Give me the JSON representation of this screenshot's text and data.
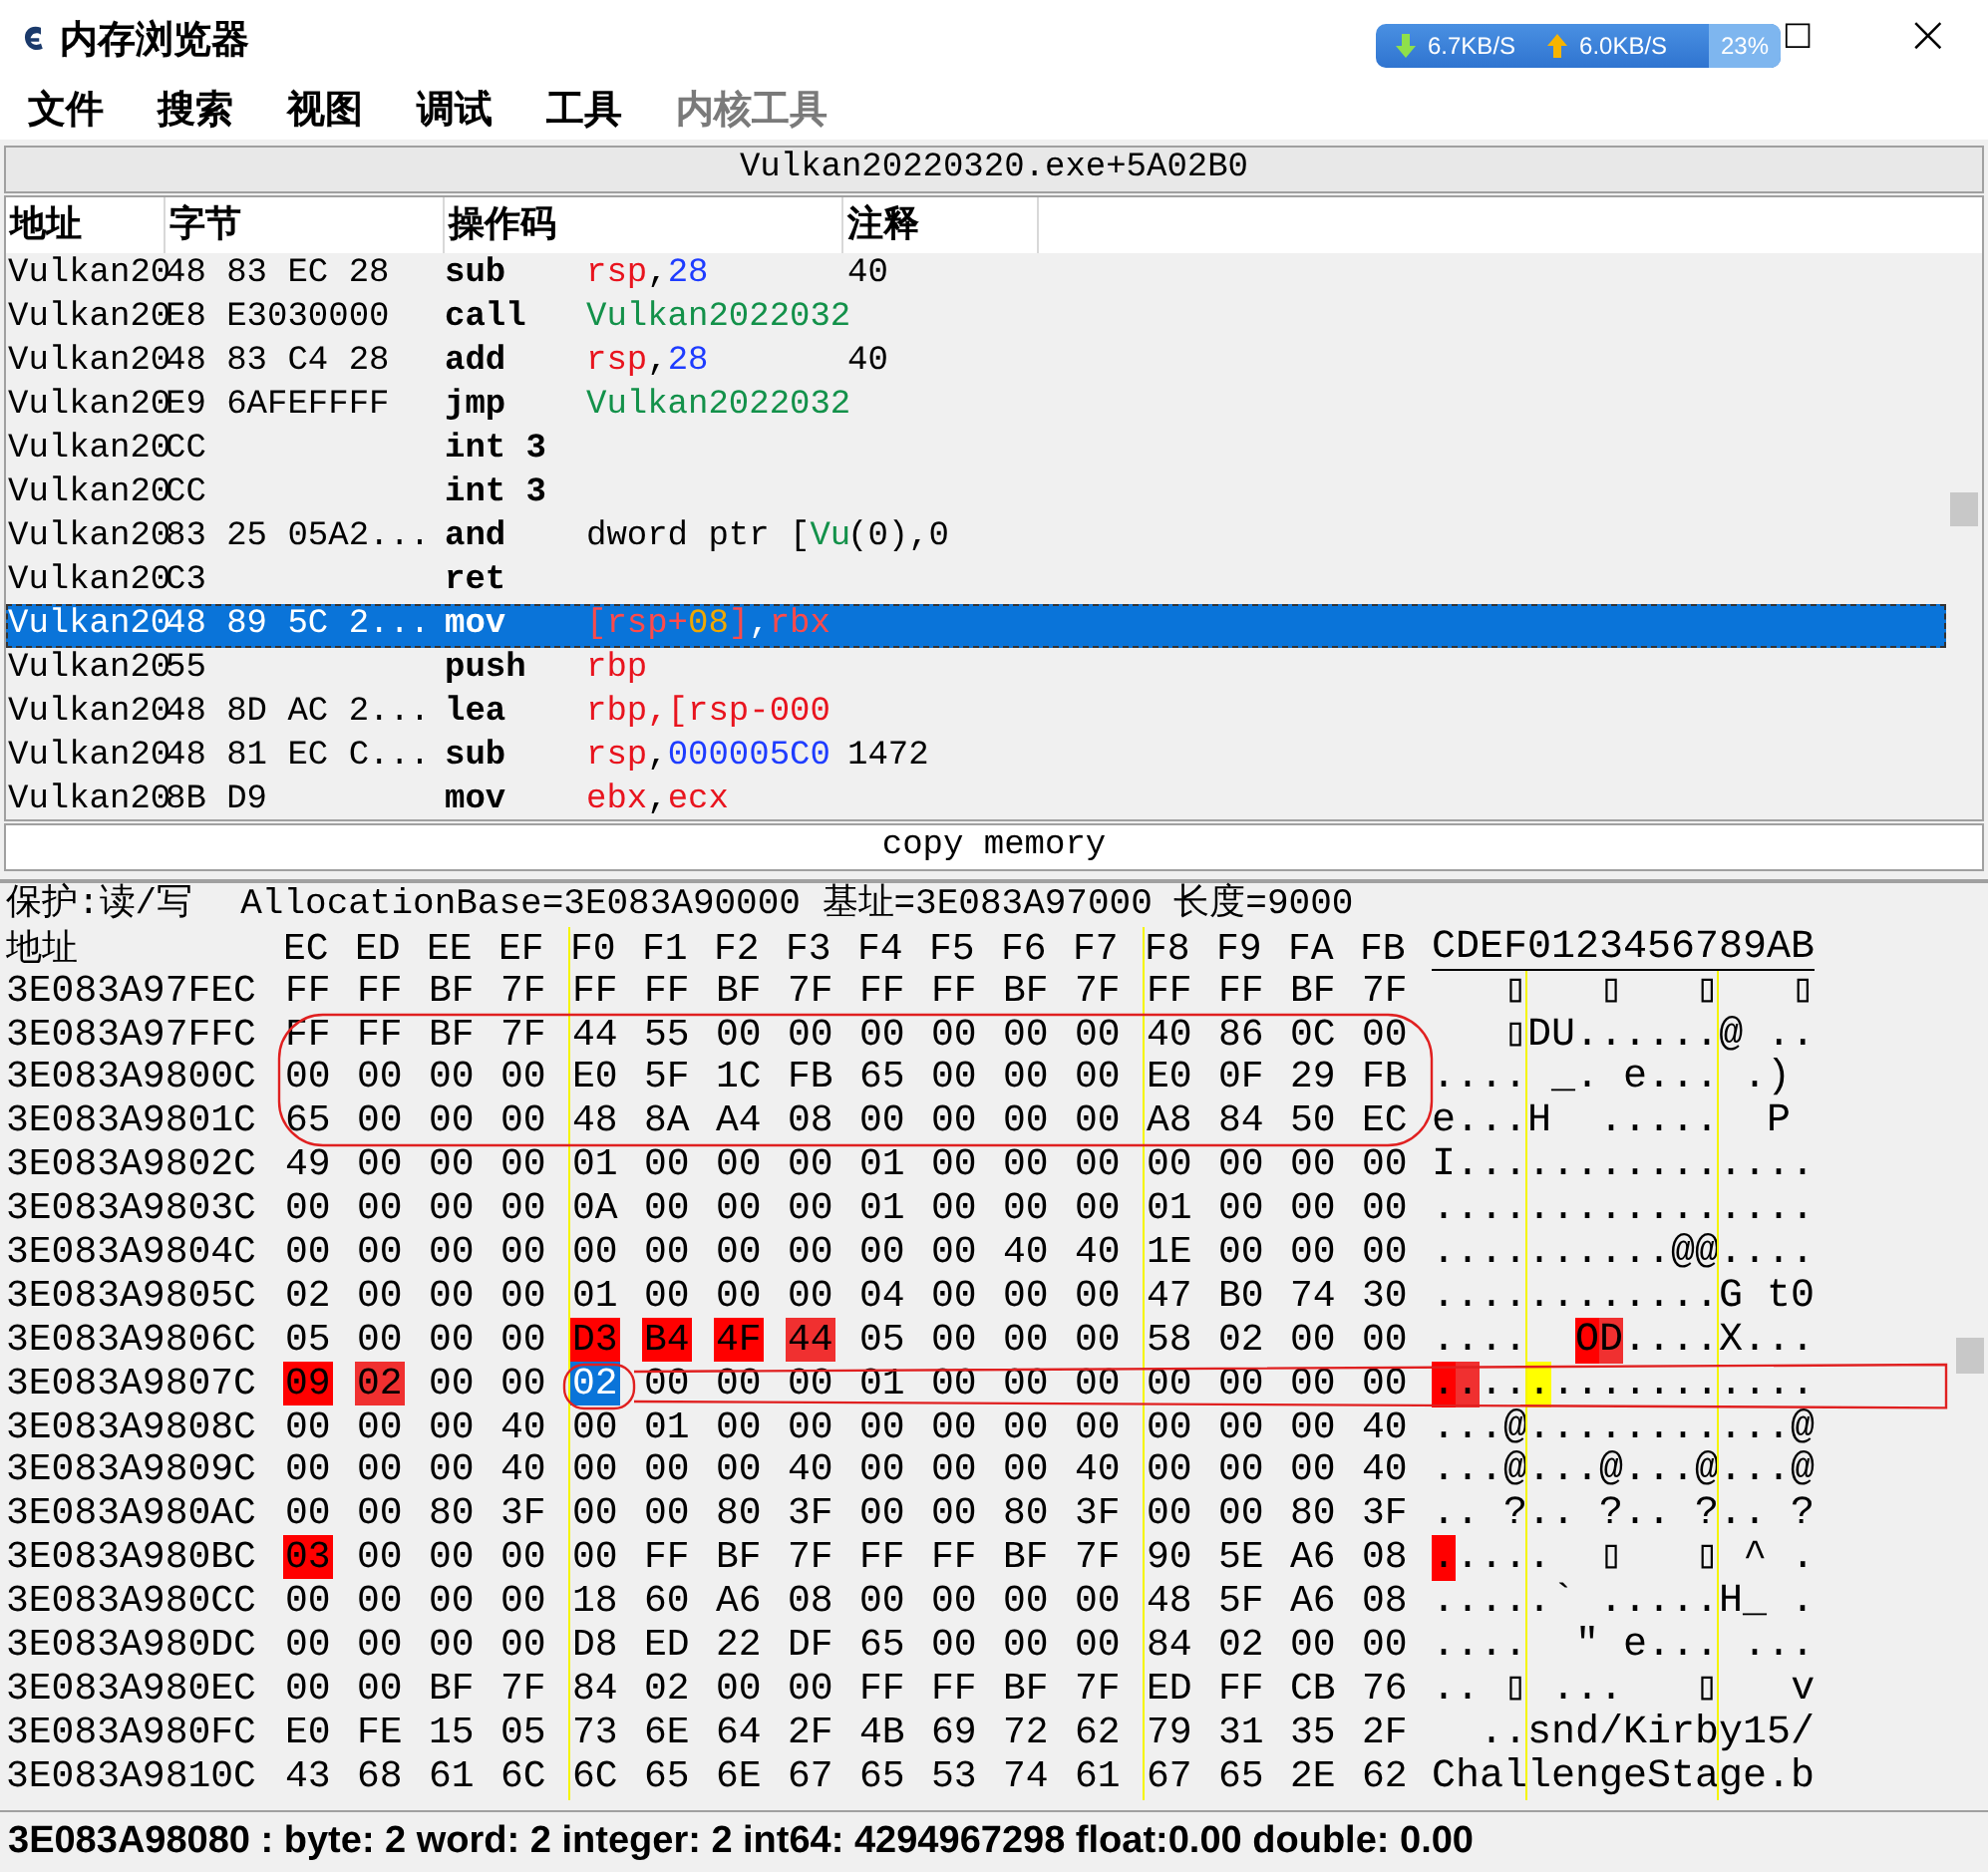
{
  "window": {
    "title": "内存浏览器"
  },
  "network_widget": {
    "download": "6.7KB/S",
    "upload": "6.0KB/S",
    "usage": "23%"
  },
  "window_controls": {
    "maximize": "□",
    "close": "×"
  },
  "menu": [
    {
      "label": "文件",
      "disabled": false
    },
    {
      "label": "搜索",
      "disabled": false
    },
    {
      "label": "视图",
      "disabled": false
    },
    {
      "label": "调试",
      "disabled": false
    },
    {
      "label": "工具",
      "disabled": false
    },
    {
      "label": "内核工具",
      "disabled": true
    }
  ],
  "address_bar": "Vulkan20220320.exe+5A02B0",
  "disassembly": {
    "columns": [
      "地址",
      "字节",
      "操作码",
      "注释"
    ],
    "rows": [
      {
        "address": "Vulkan20",
        "bytes": "48 83 EC 28",
        "opcode": "sub",
        "operands": [
          {
            "text": "rsp",
            "kind": "reg"
          },
          {
            "text": ",",
            "kind": "plain"
          },
          {
            "text": "28",
            "kind": "num"
          }
        ],
        "comment": "40",
        "selected": false
      },
      {
        "address": "Vulkan20",
        "bytes": "E8 E3030000",
        "opcode": "call",
        "operands": [
          {
            "text": "Vulkan2022032",
            "kind": "sym"
          }
        ],
        "comment": "",
        "selected": false
      },
      {
        "address": "Vulkan20",
        "bytes": "48 83 C4 28",
        "opcode": "add",
        "operands": [
          {
            "text": "rsp",
            "kind": "reg"
          },
          {
            "text": ",",
            "kind": "plain"
          },
          {
            "text": "28",
            "kind": "num"
          }
        ],
        "comment": "40",
        "selected": false
      },
      {
        "address": "Vulkan20",
        "bytes": "E9 6AFEFFFF",
        "opcode": "jmp",
        "operands": [
          {
            "text": "Vulkan2022032",
            "kind": "sym"
          }
        ],
        "comment": "",
        "selected": false
      },
      {
        "address": "Vulkan20",
        "bytes": "CC",
        "opcode": "int 3",
        "operands": [],
        "comment": "",
        "selected": false
      },
      {
        "address": "Vulkan20",
        "bytes": "CC",
        "opcode": "int 3",
        "operands": [],
        "comment": "",
        "selected": false
      },
      {
        "address": "Vulkan20",
        "bytes": "83 25 05A2...",
        "opcode": "and",
        "operands": [
          {
            "text": "dword ptr [",
            "kind": "plain"
          },
          {
            "text": "Vu",
            "kind": "sym"
          }
        ],
        "comment": "(0),0",
        "selected": false
      },
      {
        "address": "Vulkan20",
        "bytes": "C3",
        "opcode": "ret",
        "operands": [],
        "comment": "",
        "selected": false
      },
      {
        "address": "Vulkan20",
        "bytes": "48 89 5C 2...",
        "opcode": "mov",
        "operands": [
          {
            "text": "[rsp+",
            "kind": "reg"
          },
          {
            "text": "08",
            "kind": "off"
          },
          {
            "text": "]",
            "kind": "reg"
          },
          {
            "text": ",",
            "kind": "plain"
          },
          {
            "text": "rbx",
            "kind": "reg"
          }
        ],
        "comment": "",
        "selected": true
      },
      {
        "address": "Vulkan20",
        "bytes": "55",
        "opcode": "push",
        "operands": [
          {
            "text": "rbp",
            "kind": "reg"
          }
        ],
        "comment": "",
        "selected": false
      },
      {
        "address": "Vulkan20",
        "bytes": "48 8D AC 2...",
        "opcode": "lea",
        "operands": [
          {
            "text": "rbp",
            "kind": "reg"
          },
          {
            "text": ",[rsp-000",
            "kind": "reg"
          }
        ],
        "comment": "",
        "selected": false
      },
      {
        "address": "Vulkan20",
        "bytes": "48 81 EC C...",
        "opcode": "sub",
        "operands": [
          {
            "text": "rsp",
            "kind": "reg"
          },
          {
            "text": ",",
            "kind": "plain"
          },
          {
            "text": "000005C0",
            "kind": "num"
          }
        ],
        "comment": "1472",
        "selected": false
      },
      {
        "address": "Vulkan20",
        "bytes": "8B D9",
        "opcode": "mov",
        "operands": [
          {
            "text": "ebx",
            "kind": "reg"
          },
          {
            "text": ",",
            "kind": "plain"
          },
          {
            "text": "ecx",
            "kind": "reg"
          }
        ],
        "comment": "",
        "selected": false
      }
    ]
  },
  "splitter_label": "copy memory",
  "hex_view": {
    "protection": "保护:读/写",
    "region_info": "AllocationBase=3E083A90000 基址=3E083A97000 长度=9000",
    "address_heading": "地址",
    "columns": [
      "EC",
      "ED",
      "EE",
      "EF",
      "F0",
      "F1",
      "F2",
      "F3",
      "F4",
      "F5",
      "F6",
      "F7",
      "F8",
      "F9",
      "FA",
      "FB"
    ],
    "ascii_heading": "CDEF0123456789AB",
    "rows": [
      {
        "address": "3E083A97FEC",
        "bytes": [
          "FF",
          "FF",
          "BF",
          "7F",
          "FF",
          "FF",
          "BF",
          "7F",
          "FF",
          "FF",
          "BF",
          "7F",
          "FF",
          "FF",
          "BF",
          "7F"
        ],
        "ascii": "   ▯   ▯   ▯   ▯"
      },
      {
        "address": "3E083A97FFC",
        "bytes": [
          "FF",
          "FF",
          "BF",
          "7F",
          "44",
          "55",
          "00",
          "00",
          "00",
          "00",
          "00",
          "00",
          "40",
          "86",
          "0C",
          "00"
        ],
        "ascii": "   ▯DU......@ .."
      },
      {
        "address": "3E083A9800C",
        "bytes": [
          "00",
          "00",
          "00",
          "00",
          "E0",
          "5F",
          "1C",
          "FB",
          "65",
          "00",
          "00",
          "00",
          "E0",
          "0F",
          "29",
          "FB"
        ],
        "ascii": ".... _. e... .) "
      },
      {
        "address": "3E083A9801C",
        "bytes": [
          "65",
          "00",
          "00",
          "00",
          "48",
          "8A",
          "A4",
          "08",
          "00",
          "00",
          "00",
          "00",
          "A8",
          "84",
          "50",
          "EC"
        ],
        "ascii": "e...H  .....  P "
      },
      {
        "address": "3E083A9802C",
        "bytes": [
          "49",
          "00",
          "00",
          "00",
          "01",
          "00",
          "00",
          "00",
          "01",
          "00",
          "00",
          "00",
          "00",
          "00",
          "00",
          "00"
        ],
        "ascii": "I..............."
      },
      {
        "address": "3E083A9803C",
        "bytes": [
          "00",
          "00",
          "00",
          "00",
          "0A",
          "00",
          "00",
          "00",
          "01",
          "00",
          "00",
          "00",
          "01",
          "00",
          "00",
          "00"
        ],
        "ascii": "................"
      },
      {
        "address": "3E083A9804C",
        "bytes": [
          "00",
          "00",
          "00",
          "00",
          "00",
          "00",
          "00",
          "00",
          "00",
          "00",
          "40",
          "40",
          "1E",
          "00",
          "00",
          "00"
        ],
        "ascii": "..........@@...."
      },
      {
        "address": "3E083A9805C",
        "bytes": [
          "02",
          "00",
          "00",
          "00",
          "01",
          "00",
          "00",
          "00",
          "04",
          "00",
          "00",
          "00",
          "47",
          "B0",
          "74",
          "30"
        ],
        "ascii": "............G t0"
      },
      {
        "address": "3E083A9806C",
        "bytes": [
          "05",
          "00",
          "00",
          "00",
          {
            "text": "D3",
            "color": "#ff0000"
          },
          {
            "text": "B4",
            "color": "#ff0000"
          },
          {
            "text": "4F",
            "color": "#ff0000"
          },
          {
            "text": "44",
            "color": "#f03030"
          },
          "05",
          "00",
          "00",
          "00",
          "58",
          "02",
          "00",
          "00"
        ],
        "ascii": [
          {
            "text": "....  "
          },
          {
            "text": "O",
            "color": "#ff0000"
          },
          {
            "text": "D",
            "color": "#f03030"
          },
          {
            "text": "....X..."
          }
        ]
      },
      {
        "address": "3E083A9807C",
        "bytes": [
          {
            "text": "09",
            "color": "#ff0000"
          },
          {
            "text": "02",
            "color": "#f03030"
          },
          "00",
          "00",
          {
            "text": "02",
            "selected": true
          },
          "00",
          "00",
          "00",
          "01",
          "00",
          "00",
          "00",
          "00",
          "00",
          "00",
          "00"
        ],
        "ascii": [
          {
            "text": ".",
            "color": "#ff0000"
          },
          {
            "text": ".",
            "color": "#f03030"
          },
          {
            "text": ".."
          },
          {
            "text": ".",
            "color": "#ffff00"
          },
          {
            "text": "..........."
          }
        ]
      },
      {
        "address": "3E083A9808C",
        "bytes": [
          "00",
          "00",
          "00",
          "40",
          "00",
          "01",
          "00",
          "00",
          "00",
          "00",
          "00",
          "00",
          "00",
          "00",
          "00",
          "40"
        ],
        "ascii": "...@...........@"
      },
      {
        "address": "3E083A9809C",
        "bytes": [
          "00",
          "00",
          "00",
          "40",
          "00",
          "00",
          "00",
          "40",
          "00",
          "00",
          "00",
          "40",
          "00",
          "00",
          "00",
          "40"
        ],
        "ascii": "...@...@...@...@"
      },
      {
        "address": "3E083A980AC",
        "bytes": [
          "00",
          "00",
          "80",
          "3F",
          "00",
          "00",
          "80",
          "3F",
          "00",
          "00",
          "80",
          "3F",
          "00",
          "00",
          "80",
          "3F"
        ],
        "ascii": ".. ?.. ?.. ?.. ?"
      },
      {
        "address": "3E083A980BC",
        "bytes": [
          {
            "text": "03",
            "color": "#ff0000"
          },
          "00",
          "00",
          "00",
          "00",
          "FF",
          "BF",
          "7F",
          "FF",
          "FF",
          "BF",
          "7F",
          "90",
          "5E",
          "A6",
          "08"
        ],
        "ascii": [
          {
            "text": ".",
            "color": "#ff0000"
          },
          {
            "text": "....  ▯   ▯ ^ ."
          }
        ]
      },
      {
        "address": "3E083A980CC",
        "bytes": [
          "00",
          "00",
          "00",
          "00",
          "18",
          "60",
          "A6",
          "08",
          "00",
          "00",
          "00",
          "00",
          "48",
          "5F",
          "A6",
          "08"
        ],
        "ascii": ".....` .....H_ ."
      },
      {
        "address": "3E083A980DC",
        "bytes": [
          "00",
          "00",
          "00",
          "00",
          "D8",
          "ED",
          "22",
          "DF",
          "65",
          "00",
          "00",
          "00",
          "84",
          "02",
          "00",
          "00"
        ],
        "ascii": "....  \" e... ..."
      },
      {
        "address": "3E083A980EC",
        "bytes": [
          "00",
          "00",
          "BF",
          "7F",
          "84",
          "02",
          "00",
          "00",
          "FF",
          "FF",
          "BF",
          "7F",
          "ED",
          "FF",
          "CB",
          "76"
        ],
        "ascii": ".. ▯ ...   ▯   v"
      },
      {
        "address": "3E083A980FC",
        "bytes": [
          "E0",
          "FE",
          "15",
          "05",
          "73",
          "6E",
          "64",
          "2F",
          "4B",
          "69",
          "72",
          "62",
          "79",
          "31",
          "35",
          "2F"
        ],
        "ascii": "  ..snd/Kirby15/"
      },
      {
        "address": "3E083A9810C",
        "bytes": [
          "43",
          "68",
          "61",
          "6C",
          "6C",
          "65",
          "6E",
          "67",
          "65",
          "53",
          "74",
          "61",
          "67",
          "65",
          "2E",
          "62"
        ],
        "ascii": "ChallengeStage.b"
      }
    ]
  },
  "status_bar": "3E083A98080 : byte: 2 word: 2 integer: 2 int64: 4294967298 float:0.00 double: 0.00"
}
